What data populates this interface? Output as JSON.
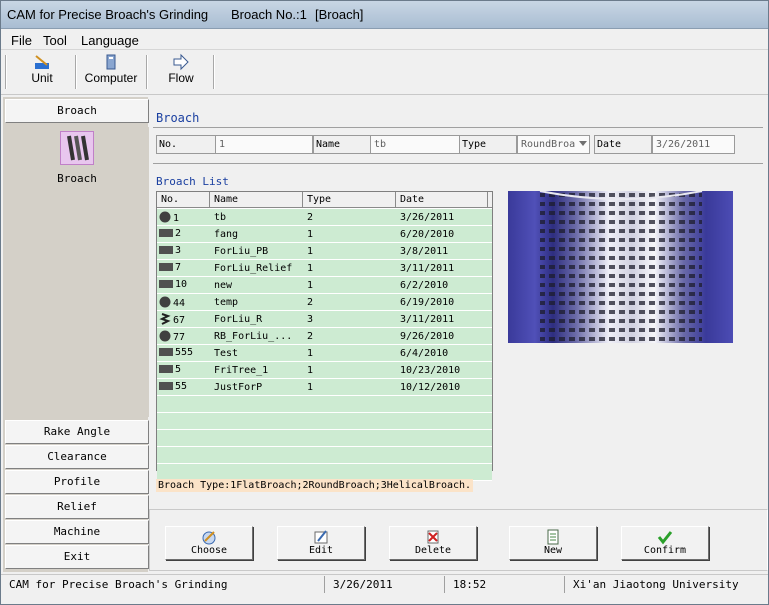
{
  "window": {
    "title_app": "CAM for Precise Broach's Grinding",
    "title_broach": "Broach No.:1",
    "title_tag": "[Broach]"
  },
  "menu": [
    "File",
    "Tool",
    "Language"
  ],
  "toolbar": {
    "unit": "Unit",
    "computer": "Computer",
    "flow": "Flow"
  },
  "sidebar": {
    "top_button": "Broach",
    "active_label": "Broach",
    "buttons": [
      "Rake Angle",
      "Clearance",
      "Profile",
      "Relief",
      "Machine",
      "Exit"
    ]
  },
  "broach_panel": {
    "title": "Broach",
    "no_label": "No.",
    "no_value": "1",
    "name_label": "Name",
    "name_value": "tb",
    "type_label": "Type",
    "type_value": "RoundBroa",
    "date_label": "Date",
    "date_value": "3/26/2011"
  },
  "list": {
    "title": "Broach List",
    "columns": [
      "No.",
      "Name",
      "Type",
      "Date"
    ],
    "rows": [
      {
        "no": "1",
        "name": "tb",
        "type": "2",
        "date": "3/26/2011",
        "icon": "round-icon"
      },
      {
        "no": "2",
        "name": "fang",
        "type": "1",
        "date": "6/20/2010",
        "icon": "flat-icon"
      },
      {
        "no": "3",
        "name": "ForLiu_PB",
        "type": "1",
        "date": "3/8/2011",
        "icon": "flat-icon"
      },
      {
        "no": "7",
        "name": "ForLiu_Relief",
        "type": "1",
        "date": "3/11/2011",
        "icon": "flat-icon"
      },
      {
        "no": "10",
        "name": "new",
        "type": "1",
        "date": "6/2/2010",
        "icon": "flat-icon"
      },
      {
        "no": "44",
        "name": "temp",
        "type": "2",
        "date": "6/19/2010",
        "icon": "round-icon"
      },
      {
        "no": "67",
        "name": "ForLiu_R",
        "type": "3",
        "date": "3/11/2011",
        "icon": "helical-icon"
      },
      {
        "no": "77",
        "name": "RB_ForLiu_...",
        "type": "2",
        "date": "9/26/2010",
        "icon": "round-icon"
      },
      {
        "no": "555",
        "name": "Test",
        "type": "1",
        "date": "6/4/2010",
        "icon": "flat-icon"
      },
      {
        "no": "5",
        "name": "FriTree_1",
        "type": "1",
        "date": "10/23/2010",
        "icon": "flat-icon"
      },
      {
        "no": "55",
        "name": "JustForP",
        "type": "1",
        "date": "10/12/2010",
        "icon": "flat-icon"
      }
    ],
    "legend": "Broach Type:1FlatBroach;2RoundBroach;3HelicalBroach."
  },
  "actions": [
    "Choose",
    "Edit",
    "Delete",
    "New",
    "Confirm"
  ],
  "status": {
    "app": "CAM for Precise Broach's Grinding",
    "date": "3/26/2011",
    "time": "18:52",
    "org": "Xi'an Jiaotong University"
  }
}
